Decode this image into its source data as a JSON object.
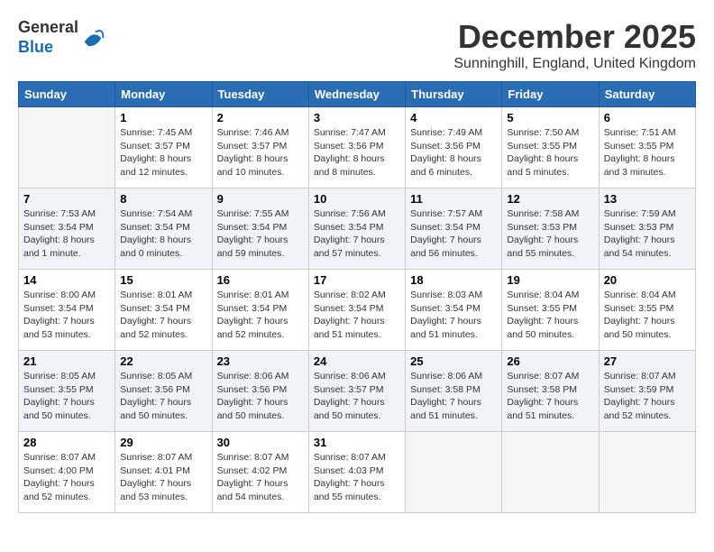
{
  "header": {
    "logo_general": "General",
    "logo_blue": "Blue",
    "month_title": "December 2025",
    "location": "Sunninghill, England, United Kingdom"
  },
  "calendar": {
    "days_of_week": [
      "Sunday",
      "Monday",
      "Tuesday",
      "Wednesday",
      "Thursday",
      "Friday",
      "Saturday"
    ],
    "weeks": [
      [
        {
          "day": "",
          "info": ""
        },
        {
          "day": "1",
          "info": "Sunrise: 7:45 AM\nSunset: 3:57 PM\nDaylight: 8 hours\nand 12 minutes."
        },
        {
          "day": "2",
          "info": "Sunrise: 7:46 AM\nSunset: 3:57 PM\nDaylight: 8 hours\nand 10 minutes."
        },
        {
          "day": "3",
          "info": "Sunrise: 7:47 AM\nSunset: 3:56 PM\nDaylight: 8 hours\nand 8 minutes."
        },
        {
          "day": "4",
          "info": "Sunrise: 7:49 AM\nSunset: 3:56 PM\nDaylight: 8 hours\nand 6 minutes."
        },
        {
          "day": "5",
          "info": "Sunrise: 7:50 AM\nSunset: 3:55 PM\nDaylight: 8 hours\nand 5 minutes."
        },
        {
          "day": "6",
          "info": "Sunrise: 7:51 AM\nSunset: 3:55 PM\nDaylight: 8 hours\nand 3 minutes."
        }
      ],
      [
        {
          "day": "7",
          "info": "Sunrise: 7:53 AM\nSunset: 3:54 PM\nDaylight: 8 hours\nand 1 minute."
        },
        {
          "day": "8",
          "info": "Sunrise: 7:54 AM\nSunset: 3:54 PM\nDaylight: 8 hours\nand 0 minutes."
        },
        {
          "day": "9",
          "info": "Sunrise: 7:55 AM\nSunset: 3:54 PM\nDaylight: 7 hours\nand 59 minutes."
        },
        {
          "day": "10",
          "info": "Sunrise: 7:56 AM\nSunset: 3:54 PM\nDaylight: 7 hours\nand 57 minutes."
        },
        {
          "day": "11",
          "info": "Sunrise: 7:57 AM\nSunset: 3:54 PM\nDaylight: 7 hours\nand 56 minutes."
        },
        {
          "day": "12",
          "info": "Sunrise: 7:58 AM\nSunset: 3:53 PM\nDaylight: 7 hours\nand 55 minutes."
        },
        {
          "day": "13",
          "info": "Sunrise: 7:59 AM\nSunset: 3:53 PM\nDaylight: 7 hours\nand 54 minutes."
        }
      ],
      [
        {
          "day": "14",
          "info": "Sunrise: 8:00 AM\nSunset: 3:54 PM\nDaylight: 7 hours\nand 53 minutes."
        },
        {
          "day": "15",
          "info": "Sunrise: 8:01 AM\nSunset: 3:54 PM\nDaylight: 7 hours\nand 52 minutes."
        },
        {
          "day": "16",
          "info": "Sunrise: 8:01 AM\nSunset: 3:54 PM\nDaylight: 7 hours\nand 52 minutes."
        },
        {
          "day": "17",
          "info": "Sunrise: 8:02 AM\nSunset: 3:54 PM\nDaylight: 7 hours\nand 51 minutes."
        },
        {
          "day": "18",
          "info": "Sunrise: 8:03 AM\nSunset: 3:54 PM\nDaylight: 7 hours\nand 51 minutes."
        },
        {
          "day": "19",
          "info": "Sunrise: 8:04 AM\nSunset: 3:55 PM\nDaylight: 7 hours\nand 50 minutes."
        },
        {
          "day": "20",
          "info": "Sunrise: 8:04 AM\nSunset: 3:55 PM\nDaylight: 7 hours\nand 50 minutes."
        }
      ],
      [
        {
          "day": "21",
          "info": "Sunrise: 8:05 AM\nSunset: 3:55 PM\nDaylight: 7 hours\nand 50 minutes."
        },
        {
          "day": "22",
          "info": "Sunrise: 8:05 AM\nSunset: 3:56 PM\nDaylight: 7 hours\nand 50 minutes."
        },
        {
          "day": "23",
          "info": "Sunrise: 8:06 AM\nSunset: 3:56 PM\nDaylight: 7 hours\nand 50 minutes."
        },
        {
          "day": "24",
          "info": "Sunrise: 8:06 AM\nSunset: 3:57 PM\nDaylight: 7 hours\nand 50 minutes."
        },
        {
          "day": "25",
          "info": "Sunrise: 8:06 AM\nSunset: 3:58 PM\nDaylight: 7 hours\nand 51 minutes."
        },
        {
          "day": "26",
          "info": "Sunrise: 8:07 AM\nSunset: 3:58 PM\nDaylight: 7 hours\nand 51 minutes."
        },
        {
          "day": "27",
          "info": "Sunrise: 8:07 AM\nSunset: 3:59 PM\nDaylight: 7 hours\nand 52 minutes."
        }
      ],
      [
        {
          "day": "28",
          "info": "Sunrise: 8:07 AM\nSunset: 4:00 PM\nDaylight: 7 hours\nand 52 minutes."
        },
        {
          "day": "29",
          "info": "Sunrise: 8:07 AM\nSunset: 4:01 PM\nDaylight: 7 hours\nand 53 minutes."
        },
        {
          "day": "30",
          "info": "Sunrise: 8:07 AM\nSunset: 4:02 PM\nDaylight: 7 hours\nand 54 minutes."
        },
        {
          "day": "31",
          "info": "Sunrise: 8:07 AM\nSunset: 4:03 PM\nDaylight: 7 hours\nand 55 minutes."
        },
        {
          "day": "",
          "info": ""
        },
        {
          "day": "",
          "info": ""
        },
        {
          "day": "",
          "info": ""
        }
      ]
    ]
  }
}
